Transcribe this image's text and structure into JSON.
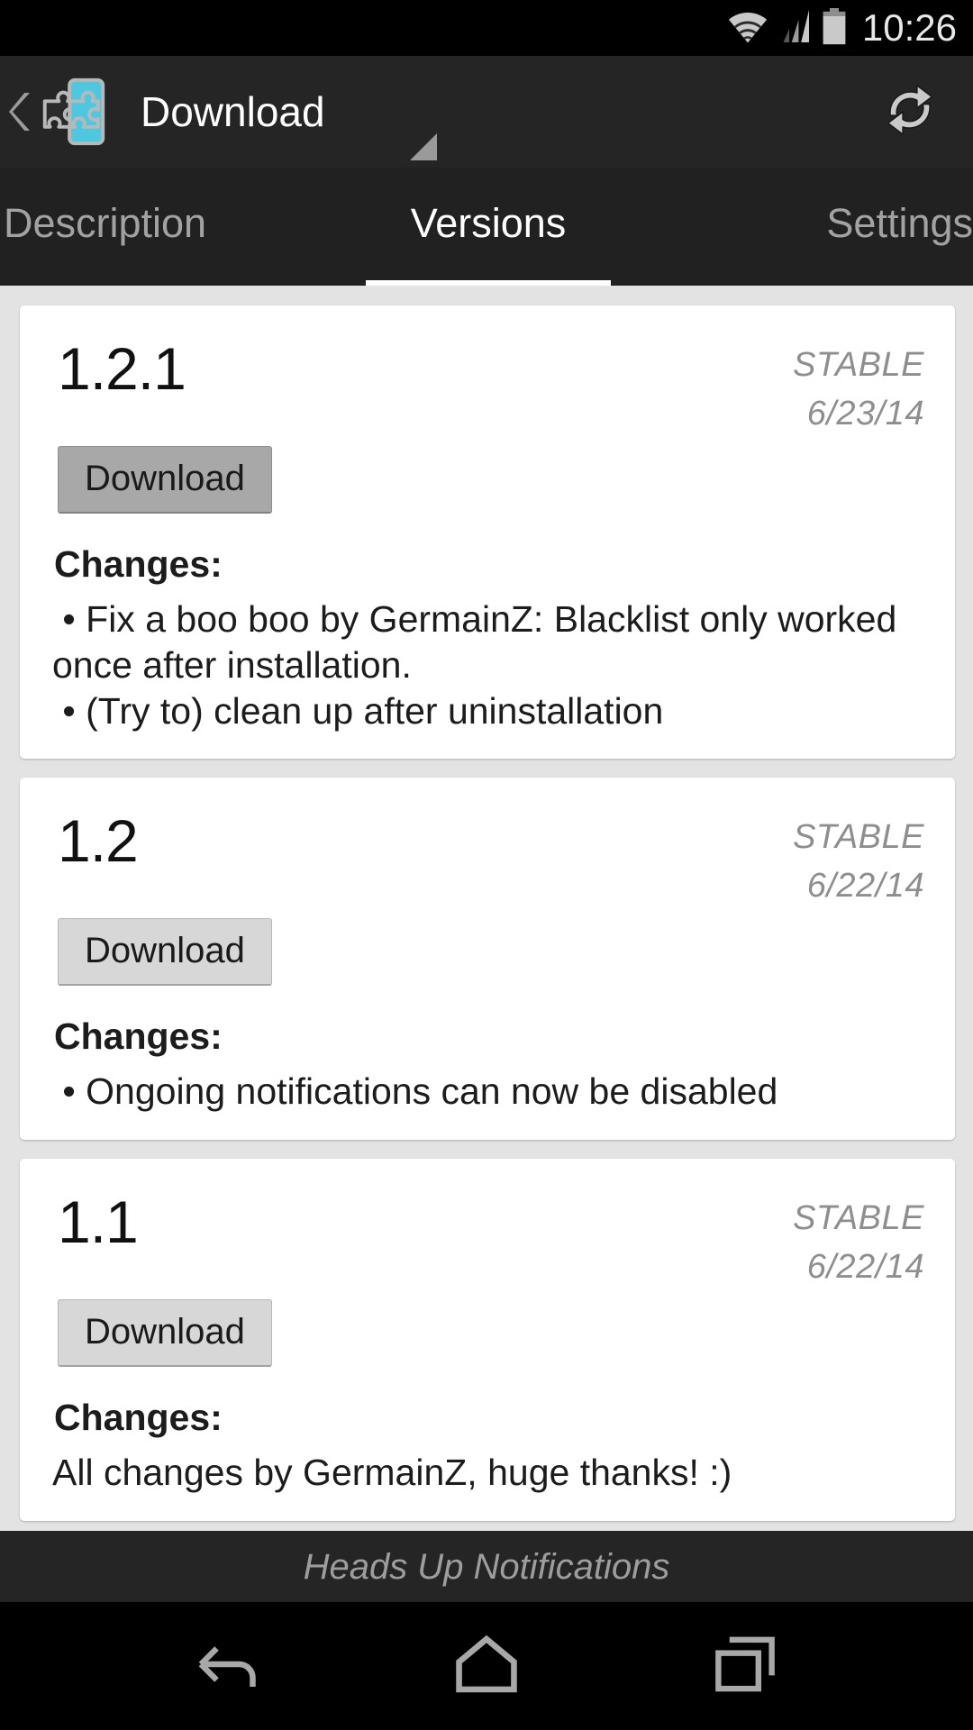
{
  "status_bar": {
    "time": "10:26",
    "icons": [
      "wifi-icon",
      "cellular-signal-icon",
      "battery-icon"
    ]
  },
  "action_bar": {
    "title": "Download",
    "up_icon": "back-caret-icon",
    "app_icon": "xposed-module-icon",
    "spinner_icon": "spinner-caret-icon",
    "refresh_icon": "refresh-icon",
    "accent_color": "#4ec8e0",
    "background_color": "#252525"
  },
  "tabs": {
    "items": [
      {
        "label": "Description",
        "active": false
      },
      {
        "label": "Versions",
        "active": true
      },
      {
        "label": "Settings",
        "active": false
      }
    ],
    "indicator_color": "#ffffff"
  },
  "versions": [
    {
      "name": "1.2.1",
      "status": "STABLE",
      "date": "6/23/14",
      "download_label": "Download",
      "button_state": "pressed",
      "changes_label": "Changes:",
      "changes_text": " • Fix a boo boo by GermainZ: Blacklist only worked once after installation.\n • (Try to) clean up after uninstallation"
    },
    {
      "name": "1.2",
      "status": "STABLE",
      "date": "6/22/14",
      "download_label": "Download",
      "button_state": "normal",
      "changes_label": "Changes:",
      "changes_text": " • Ongoing notifications can now be disabled"
    },
    {
      "name": "1.1",
      "status": "STABLE",
      "date": "6/22/14",
      "download_label": "Download",
      "button_state": "normal",
      "changes_label": "Changes:",
      "changes_text": "All changes by GermainZ, huge thanks! :)"
    }
  ],
  "footer": {
    "text": "Heads Up Notifications"
  },
  "nav_bar": {
    "back_icon": "back-arrow-icon",
    "home_icon": "home-icon",
    "recents_icon": "recents-icon"
  }
}
